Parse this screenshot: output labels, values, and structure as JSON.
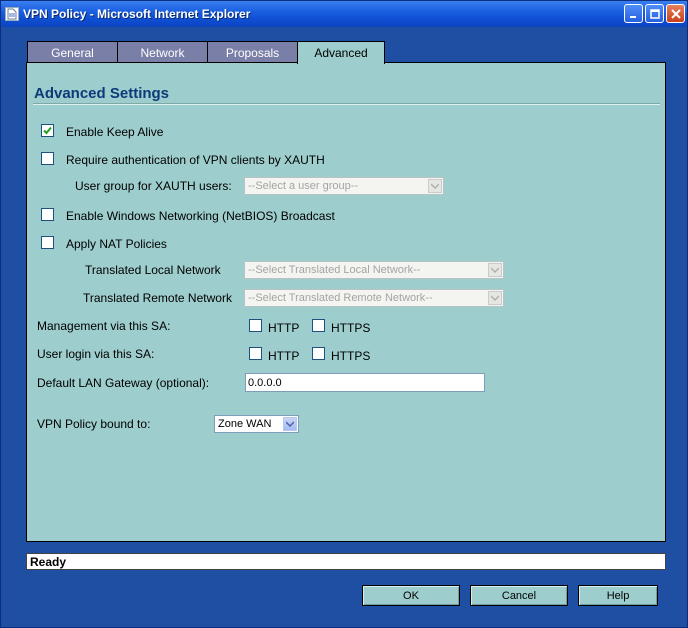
{
  "window": {
    "title": "VPN Policy - Microsoft Internet Explorer"
  },
  "tabs": [
    {
      "label": "General",
      "active": false
    },
    {
      "label": "Network",
      "active": false
    },
    {
      "label": "Proposals",
      "active": false
    },
    {
      "label": "Advanced",
      "active": true
    }
  ],
  "advanced": {
    "section_title": "Advanced Settings",
    "keep_alive": {
      "label": "Enable Keep Alive",
      "checked": true
    },
    "xauth": {
      "label": "Require authentication of VPN clients by XAUTH",
      "checked": false
    },
    "xauth_group": {
      "label": "User group for XAUTH users:",
      "value": "--Select a user group--"
    },
    "netbios": {
      "label": "Enable Windows Networking (NetBIOS) Broadcast",
      "checked": false
    },
    "nat": {
      "label": "Apply NAT Policies",
      "checked": false
    },
    "translated_local": {
      "label": "Translated Local Network",
      "value": "--Select Translated Local Network--"
    },
    "translated_remote": {
      "label": "Translated Remote Network",
      "value": "--Select Translated Remote Network--"
    },
    "management": {
      "label": "Management via this SA:",
      "http": "HTTP",
      "https": "HTTPS"
    },
    "user_login": {
      "label": "User login via this SA:",
      "http": "HTTP",
      "https": "HTTPS"
    },
    "gateway": {
      "label": "Default LAN Gateway (optional):",
      "value": "0.0.0.0"
    },
    "bound_to": {
      "label": "VPN Policy bound to:",
      "value": "Zone WAN"
    }
  },
  "status": {
    "text": "Ready"
  },
  "buttons": {
    "ok": "OK",
    "cancel": "Cancel",
    "help": "Help"
  }
}
